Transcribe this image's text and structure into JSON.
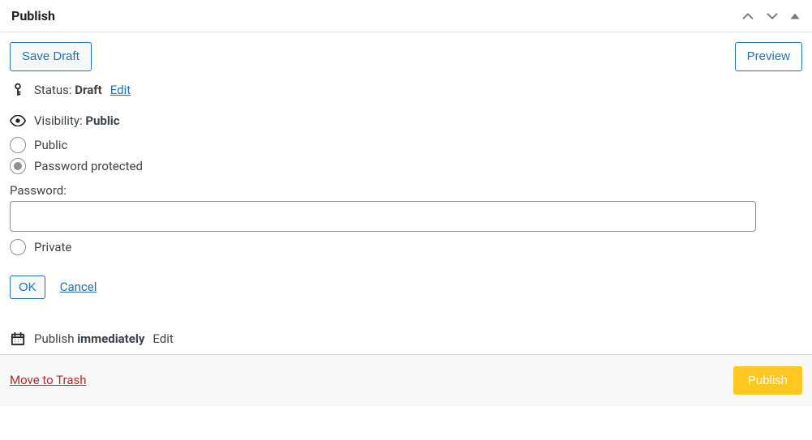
{
  "panel": {
    "title": "Publish"
  },
  "actions": {
    "save_draft": "Save Draft",
    "preview": "Preview",
    "ok": "OK",
    "cancel": "Cancel",
    "move_to_trash": "Move to Trash",
    "publish": "Publish"
  },
  "status": {
    "label": "Status:",
    "value": "Draft",
    "edit": "Edit"
  },
  "visibility": {
    "label": "Visibility:",
    "value": "Public",
    "options": {
      "public": "Public",
      "password_protected": "Password protected",
      "private": "Private"
    },
    "selected": "password_protected",
    "password_label": "Password:",
    "password_value": ""
  },
  "schedule": {
    "label": "Publish",
    "value": "immediately",
    "edit": "Edit"
  }
}
